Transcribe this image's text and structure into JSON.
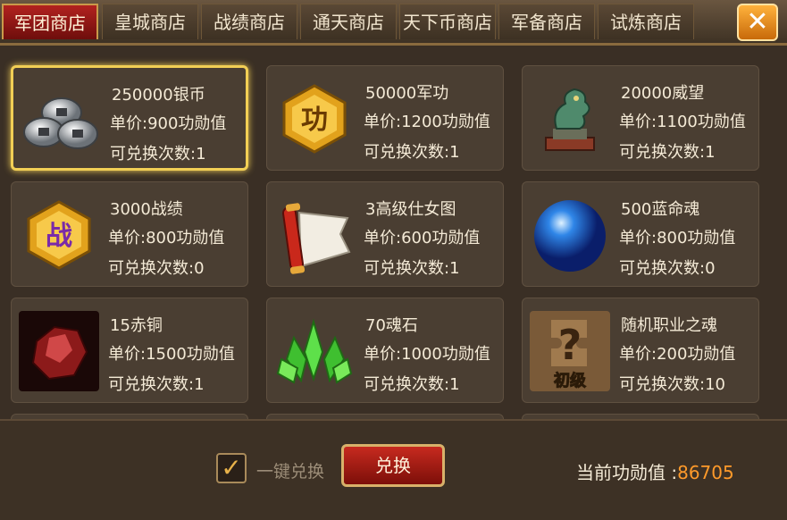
{
  "tabs": [
    {
      "label": "军团商店",
      "active": true
    },
    {
      "label": "皇城商店",
      "active": false
    },
    {
      "label": "战绩商店",
      "active": false
    },
    {
      "label": "通天商店",
      "active": false
    },
    {
      "label": "天下币商店",
      "active": false
    },
    {
      "label": "军备商店",
      "active": false
    },
    {
      "label": "试炼商店",
      "active": false
    }
  ],
  "close_icon": "close-icon",
  "items": [
    {
      "name": "250000银币",
      "price": "单价:900功勋值",
      "count": "可兑换次数:1",
      "icon": "silver-coins-icon",
      "selected": true
    },
    {
      "name": "50000军功",
      "price": "单价:1200功勋值",
      "count": "可兑换次数:1",
      "icon": "military-merit-badge-icon",
      "badge_text": "功"
    },
    {
      "name": "20000威望",
      "price": "单价:1100功勋值",
      "count": "可兑换次数:1",
      "icon": "jade-dragon-statue-icon"
    },
    {
      "name": "3000战绩",
      "price": "单价:800功勋值",
      "count": "可兑换次数:0",
      "icon": "battle-record-badge-icon",
      "badge_text": "战"
    },
    {
      "name": "3高级仕女图",
      "price": "单价:600功勋值",
      "count": "可兑换次数:1",
      "icon": "scroll-icon"
    },
    {
      "name": "500蓝命魂",
      "price": "单价:800功勋值",
      "count": "可兑换次数:0",
      "icon": "blue-orb-icon"
    },
    {
      "name": "15赤铜",
      "price": "单价:1500功勋值",
      "count": "可兑换次数:1",
      "icon": "red-ore-icon"
    },
    {
      "name": "70魂石",
      "price": "单价:1000功勋值",
      "count": "可兑换次数:1",
      "icon": "green-crystal-icon"
    },
    {
      "name": "随机职业之魂",
      "price": "单价:200功勋值",
      "count": "可兑换次数:10",
      "icon": "mystery-puzzle-icon",
      "badge_text": "初级"
    }
  ],
  "bottom": {
    "onekey_checked": true,
    "onekey_label": "一键兑换",
    "exchange_label": "兑换",
    "merit_label": "当前功勋值 :",
    "merit_value": "86705"
  },
  "colors": {
    "accent_gold": "#f2cf55",
    "tab_active": "#b2221f",
    "merit_value": "#ff9a2a"
  }
}
